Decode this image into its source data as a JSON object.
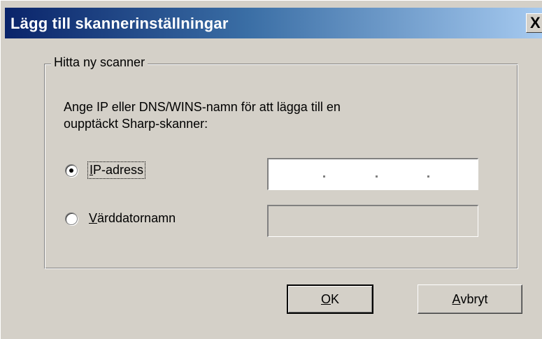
{
  "window": {
    "title": "Lägg till skannerinställningar",
    "close_label": "X"
  },
  "group": {
    "legend": "Hitta ny scanner"
  },
  "prompt_lines": [
    "Ange IP eller DNS/WINS-namn för att lägga till en",
    "oupptäckt Sharp-skanner:"
  ],
  "options": {
    "ip": {
      "label_mnemonic": "I",
      "label_rest": "P-adress",
      "selected": true
    },
    "host": {
      "label_mnemonic": "V",
      "label_rest": "ärddatornamn",
      "selected": false
    }
  },
  "ip_field": {
    "value": "",
    "separators": [
      ".",
      ".",
      "."
    ]
  },
  "host_field": {
    "value": ""
  },
  "buttons": {
    "ok": {
      "mnemonic": "O",
      "rest": "K"
    },
    "cancel": {
      "mnemonic": "A",
      "rest": "vbryt"
    }
  }
}
